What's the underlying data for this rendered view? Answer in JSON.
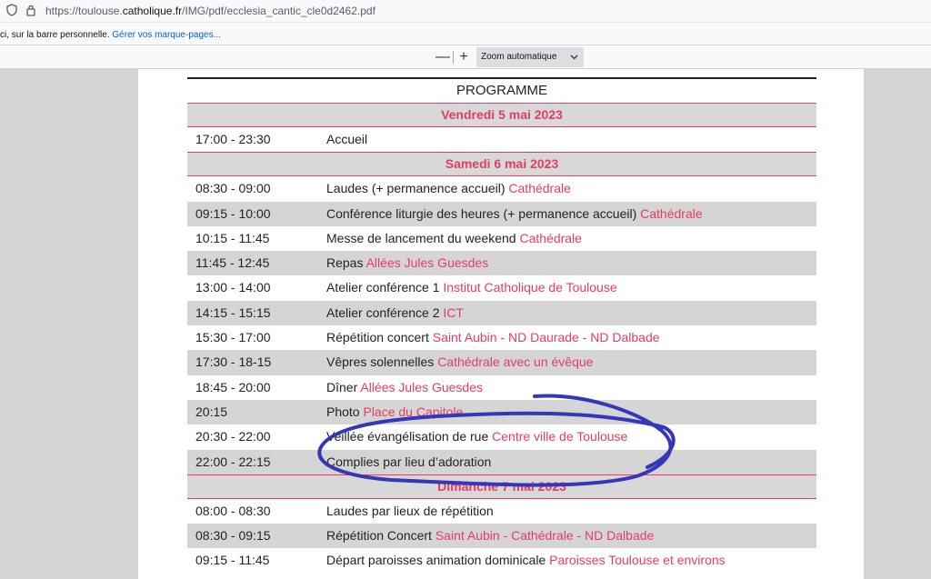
{
  "browser": {
    "url_prefix": "https://toulouse.",
    "url_domain": "catholique.fr",
    "url_path": "/IMG/pdf/ecclesia_cantic_cle0d2462.pdf",
    "bookmarks_text": "ci, sur la barre personnelle.",
    "bookmarks_link": "Gérer vos marque-pages..."
  },
  "pdf_toolbar": {
    "zoom_out": "—",
    "zoom_in": "+",
    "zoom_label": "Zoom automatique"
  },
  "program": {
    "title": "PROGRAMME",
    "days": [
      {
        "label": "Vendredi 5 mai 2023",
        "rows": [
          {
            "time": "17:00 - 23:30",
            "activity": "Accueil",
            "location": ""
          }
        ]
      },
      {
        "label": "Samedi 6 mai 2023",
        "rows": [
          {
            "time": "08:30 - 09:00",
            "activity": "Laudes (+ permanence accueil) ",
            "location": "Cathédrale"
          },
          {
            "time": "09:15 - 10:00",
            "activity": "Conférence liturgie des heures (+ permanence accueil) ",
            "location": "Cathédrale"
          },
          {
            "time": "10:15 - 11:45",
            "activity": "Messe de lancement du weekend ",
            "location": "Cathédrale"
          },
          {
            "time": "11:45 - 12:45",
            "activity": "Repas ",
            "location": "Allées Jules Guesdes"
          },
          {
            "time": "13:00 - 14:00",
            "activity": "Atelier conférence 1 ",
            "location": "Institut Catholique de Toulouse"
          },
          {
            "time": "14:15 - 15:15",
            "activity": "Atelier conférence 2 ",
            "location": "ICT"
          },
          {
            "time": "15:30 - 17:00",
            "activity": "Répétition concert ",
            "location": "Saint Aubin - ND Daurade - ND Dalbade"
          },
          {
            "time": "17:30 - 18-15",
            "activity": "Vêpres solennelles ",
            "location": "Cathédrale avec un évêque"
          },
          {
            "time": "18:45 - 20:00",
            "activity": "Dîner ",
            "location": "Allées Jules Guesdes"
          },
          {
            "time": "20:15",
            "activity": "Photo ",
            "location": "Place du Capitole"
          },
          {
            "time": "20:30 - 22:00",
            "activity": "Veillée évangélisation de rue ",
            "location": "Centre ville de Toulouse"
          },
          {
            "time": "22:00 - 22:15",
            "activity": "Complies par lieu d’adoration",
            "location": ""
          }
        ]
      },
      {
        "label": "Dimanche 7 mai 2023",
        "rows": [
          {
            "time": "08:00 - 08:30",
            "activity": "Laudes par lieux de répétition",
            "location": ""
          },
          {
            "time": "08:30 - 09:15",
            "activity": "Répétition Concert ",
            "location": "Saint Aubin - Cathédrale - ND Dalbade"
          },
          {
            "time": "09:15 - 11:45",
            "activity": "Départ paroisses animation dominicale ",
            "location": "Paroisses Toulouse et environs"
          }
        ]
      }
    ]
  },
  "colors": {
    "accent": "#e63c64",
    "row_alt": "#d5d5d5",
    "scribble": "#3636b8"
  },
  "icons": [
    "shield-icon",
    "lock-icon",
    "chevron-down-icon"
  ]
}
